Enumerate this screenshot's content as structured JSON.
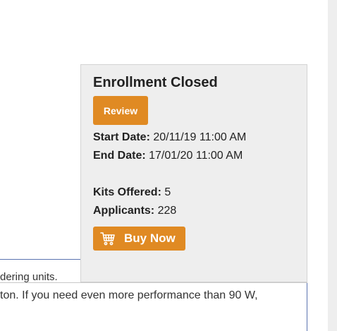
{
  "background": {
    "line1": "dering units.",
    "line2": "ton. If you need even more performance than 90 W,"
  },
  "enrollment": {
    "title": "Enrollment Closed",
    "review_label": "Review",
    "start_label": "Start Date:",
    "start_value": "20/11/19 11:00 AM",
    "end_label": "End Date:",
    "end_value": "17/01/20 11:00 AM",
    "kits_label": "Kits Offered:",
    "kits_value": "5",
    "applicants_label": "Applicants:",
    "applicants_value": "228",
    "buy_label": "Buy Now",
    "buy_icon": "cart-icon"
  },
  "colors": {
    "accent": "#e08a23",
    "panel_bg": "#eeeeee"
  }
}
